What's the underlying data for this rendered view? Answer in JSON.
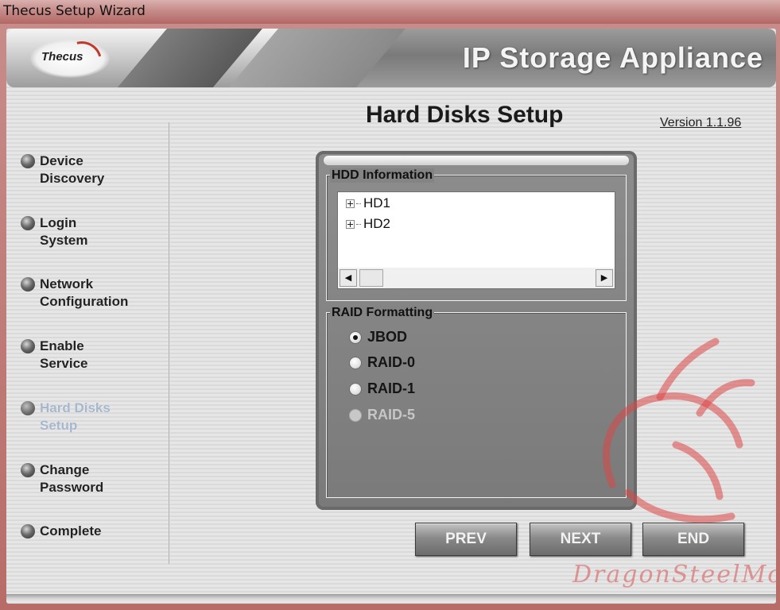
{
  "window": {
    "title": "Thecus Setup Wizard"
  },
  "banner": {
    "logo_text": "Thecus",
    "app_title": "IP Storage Appliance"
  },
  "page": {
    "title": "Hard Disks Setup",
    "version": "Version 1.1.96"
  },
  "steps": [
    {
      "line1": "Device",
      "line2": "Discovery"
    },
    {
      "line1": "Login",
      "line2": "System"
    },
    {
      "line1": "Network",
      "line2": "Configuration"
    },
    {
      "line1": "Enable",
      "line2": "Service"
    },
    {
      "line1": "Hard Disks",
      "line2": "Setup",
      "active": true
    },
    {
      "line1": "Change",
      "line2": "Password"
    },
    {
      "line1": "Complete",
      "line2": ""
    }
  ],
  "hdd": {
    "title": "HDD Information",
    "items": [
      "HD1",
      "HD2"
    ]
  },
  "raid": {
    "title": "RAID Formatting",
    "options": [
      {
        "label": "JBOD",
        "checked": true,
        "enabled": true
      },
      {
        "label": "RAID-0",
        "checked": false,
        "enabled": true
      },
      {
        "label": "RAID-1",
        "checked": false,
        "enabled": true
      },
      {
        "label": "RAID-5",
        "checked": false,
        "enabled": false
      }
    ]
  },
  "buttons": {
    "prev": "PREV",
    "next": "NEXT",
    "end": "END"
  },
  "watermark": {
    "text": "DragonSteelMods"
  },
  "colors": {
    "accent_red": "#c0392b",
    "active_step": "#a6b7cc"
  }
}
